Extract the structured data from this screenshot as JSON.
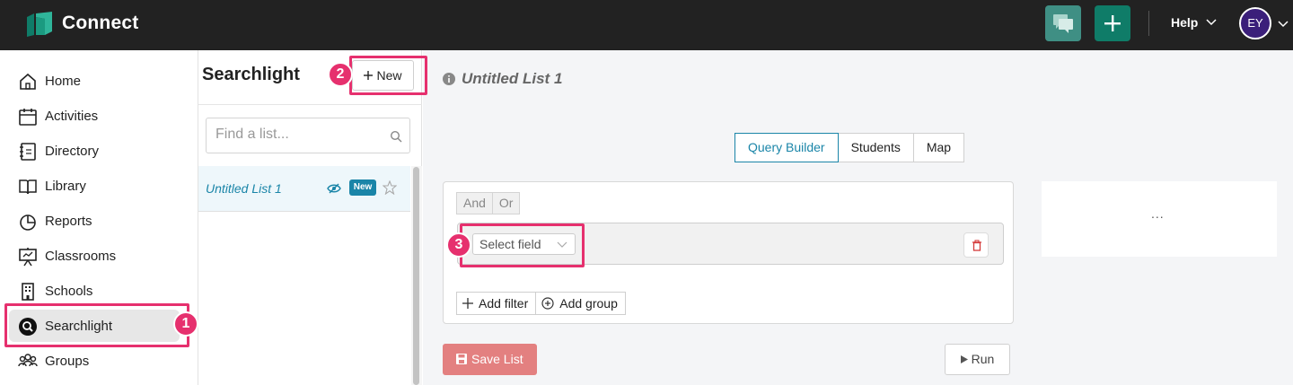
{
  "app": {
    "title": "Connect",
    "help_label": "Help",
    "user_initials": "EY",
    "colors": {
      "topbar": "#222222",
      "brand_green": "#0f7c68",
      "highlight": "#e6306e",
      "link_blue": "#1a85a8",
      "save_red": "#e38080"
    }
  },
  "sidebar": {
    "items": [
      {
        "label": "Home",
        "icon": "home-icon"
      },
      {
        "label": "Activities",
        "icon": "calendar-icon"
      },
      {
        "label": "Directory",
        "icon": "directory-icon"
      },
      {
        "label": "Library",
        "icon": "book-icon"
      },
      {
        "label": "Reports",
        "icon": "pie-chart-icon"
      },
      {
        "label": "Classrooms",
        "icon": "presentation-icon"
      },
      {
        "label": "Schools",
        "icon": "building-icon"
      },
      {
        "label": "Searchlight",
        "icon": "search-circle-icon",
        "active": true
      },
      {
        "label": "Groups",
        "icon": "groups-icon"
      }
    ]
  },
  "callouts": {
    "one": "1",
    "two": "2",
    "three": "3"
  },
  "list_panel": {
    "title": "Searchlight",
    "new_button": "New",
    "search_placeholder": "Find a list...",
    "lists": [
      {
        "name": "Untitled List 1",
        "badge": "New"
      }
    ]
  },
  "main": {
    "title": "Untitled List 1",
    "tabs": [
      {
        "label": "Query Builder",
        "active": true
      },
      {
        "label": "Students"
      },
      {
        "label": "Map"
      }
    ],
    "query": {
      "and_label": "And",
      "or_label": "Or",
      "field_select": "Select field",
      "add_filter": "Add filter",
      "add_group": "Add group"
    },
    "side_card_text": "...",
    "save_button": "Save List",
    "run_button": "Run"
  }
}
